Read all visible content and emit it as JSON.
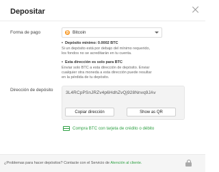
{
  "dialog": {
    "title": "Depositar"
  },
  "form": {
    "payment_label": "Forma de pago",
    "selected_currency": "Bitcoin",
    "currency_symbol": "₿"
  },
  "notes": {
    "min_heading": "Depósito mínimo: 0.0002 BTC",
    "min_text_1": "Si un depósito está por debajo del mínimo requerido,",
    "min_text_2": "los fondos no se acreditarán en tu cuenta.",
    "address_heading": "Esta dirección es solo para BTC",
    "address_text_1": "Enviar solo BTC a esta dirección de depósito. Enviar",
    "address_text_2": "cualquier otra moneda a esta dirección puede resultar",
    "address_text_3": "en la pérdida de tu depósito."
  },
  "deposit_address": {
    "label": "Dirección de depósito",
    "value": "3L4RCpPSnJRZv4p6HdhZvQj928Nnvq9JAv",
    "copy_button": "Copiar dirección",
    "qr_button": "Show as QR"
  },
  "buy": {
    "link_text": "Compra BTC con tarjeta de crédito o débito"
  },
  "footer": {
    "question": "¿Problemas para hacer depósitos? Contacte con el Servicio de ",
    "support_link": "Atención al cliente.",
    "accent": "#2ea043"
  }
}
